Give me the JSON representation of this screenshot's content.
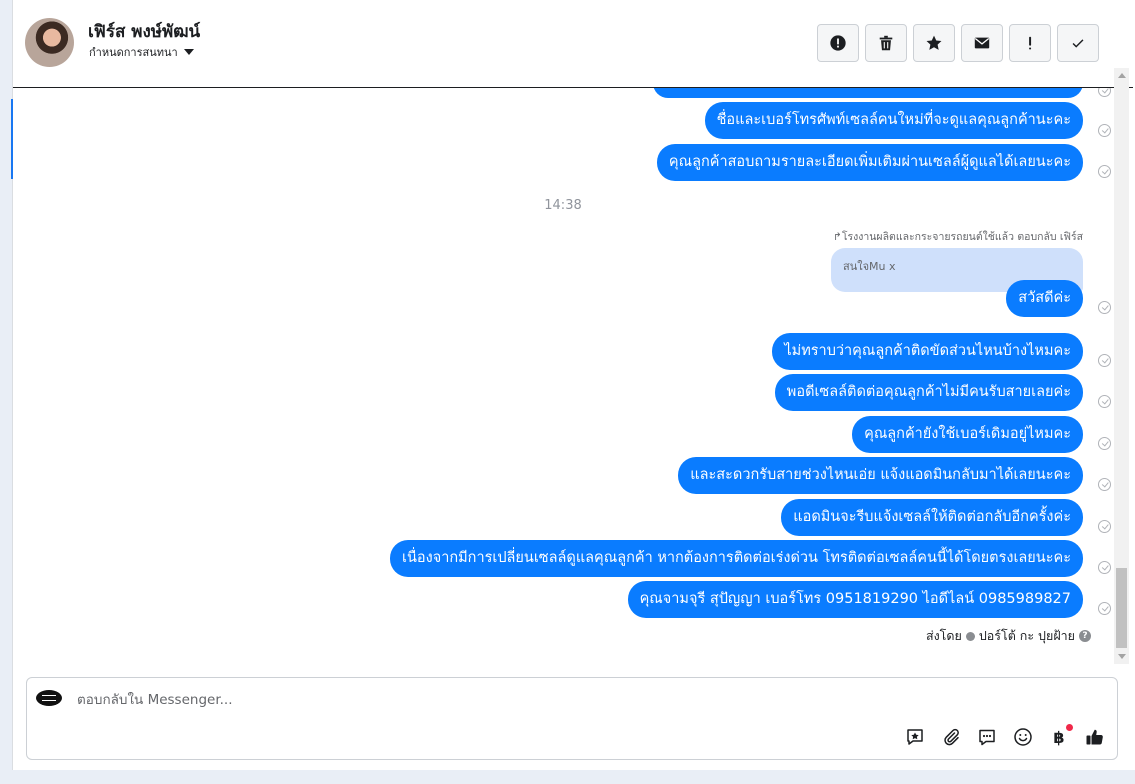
{
  "header": {
    "contact_name": "เฟิร์ส พงษ์พัฒน์",
    "assign_label": "กำหนดการสนทนา",
    "actions": [
      {
        "name": "report-spam-button",
        "icon": "alert-circle-icon"
      },
      {
        "name": "delete-button",
        "icon": "trash-icon"
      },
      {
        "name": "star-button",
        "icon": "star-icon"
      },
      {
        "name": "mark-unread-button",
        "icon": "envelope-icon"
      },
      {
        "name": "follow-up-button",
        "icon": "exclamation-icon"
      },
      {
        "name": "mark-done-button",
        "icon": "check-icon"
      }
    ]
  },
  "messages": {
    "before": [
      "",
      "ชื่อและเบอร์โทรศัพท์เซลล์คนใหม่ที่จะดูแลคุณลูกค้านะคะ",
      "คุณลูกค้าสอบถามรายละเอียดเพิ่มเติมผ่านเซลล์ผู้ดูแลได้เลยนะคะ"
    ],
    "time_separator": "14:38",
    "reply_meta": "โรงงานผลิตและกระจายรถยนต์ใช้แล้ว ตอบกลับ เฟิร์ส",
    "quoted_text": "สนใจMu x",
    "after": [
      "สวัสดีค่ะ",
      "ไม่ทราบว่าคุณลูกค้าติดขัดส่วนไหนบ้างไหมคะ",
      "พอดีเซลล์ติดต่อคุณลูกค้าไม่มีคนรับสายเลยค่ะ",
      "คุณลูกค้ายังใช้เบอร์เดิมอยู่ไหมคะ",
      "และสะดวกรับสายช่วงไหนเอ่ย แจ้งแอดมินกลับมาได้เลยนะคะ",
      "แอดมินจะรีบแจ้งเซลล์ให้ติดต่อกลับอีกครั้งค่ะ",
      "เนื่องจากมีการเปลี่ยนเซลล์ดูแลคุณลูกค้า หากต้องการติดต่อเร่งด่วน โทรติดต่อเซลล์คนนี้ได้โดยตรงเลยนะคะ",
      "คุณจามจุรี สุปัญญา เบอร์โทร 0951819290  ไอดีไลน์ 0985989827"
    ],
    "sent_by_prefix": "ส่งโดย",
    "sent_by_name": "ปอร์โต้ กะ ปุยฝ้าย"
  },
  "composer": {
    "placeholder": "ตอบกลับใน Messenger...",
    "baht_symbol": "฿",
    "accent_color": "#0a7cff"
  }
}
